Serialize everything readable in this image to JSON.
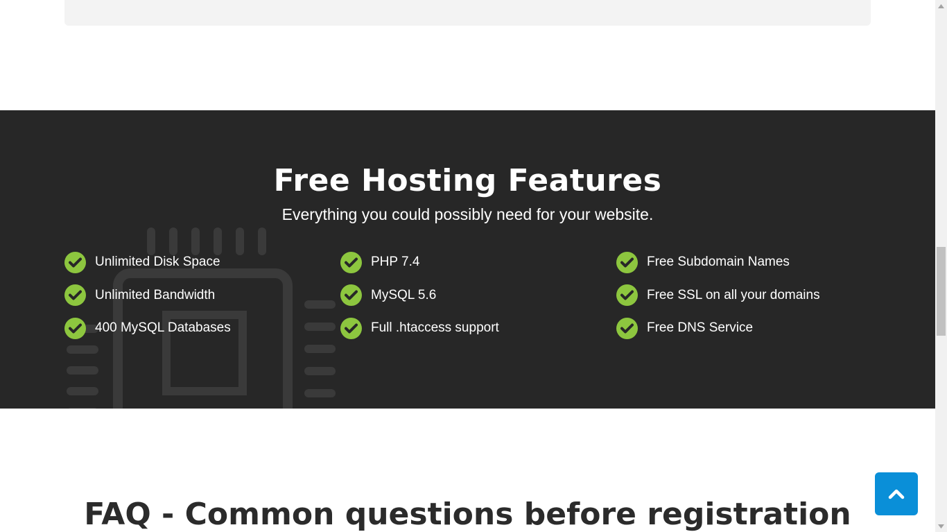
{
  "features": {
    "title": "Free Hosting Features",
    "subtitle": "Everything you could possibly need for your website.",
    "columns": [
      [
        "Unlimited Disk Space",
        "Unlimited Bandwidth",
        "400 MySQL Databases"
      ],
      [
        "PHP 7.4",
        "MySQL 5.6",
        "Full .htaccess support"
      ],
      [
        "Free Subdomain Names",
        "Free SSL on all your domains",
        "Free DNS Service"
      ]
    ]
  },
  "faq": {
    "title": "FAQ - Common questions before registration"
  },
  "icons": {
    "feature_check": "check-circle-icon",
    "background": "cpu-chip-icon",
    "back_to_top": "chevron-up-icon"
  },
  "colors": {
    "dark_section": "#272727",
    "check_green": "#8dc63f",
    "back_to_top": "#0a8fd8"
  }
}
